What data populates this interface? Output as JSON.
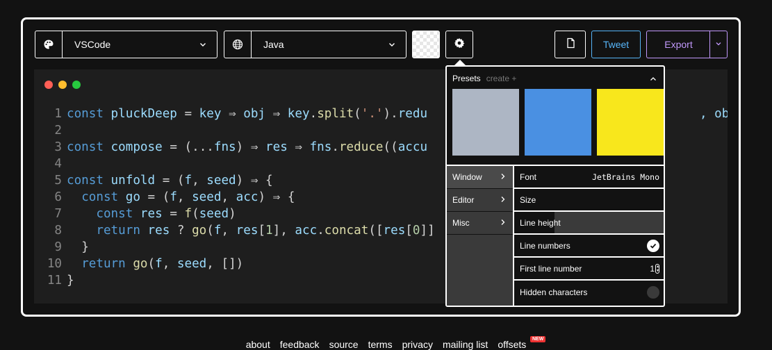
{
  "theme_select": {
    "value": "VSCode",
    "icon": "palette-icon"
  },
  "language_select": {
    "value": "Java",
    "icon": "globe-icon"
  },
  "actions": {
    "tweet_label": "Tweet",
    "export_label": "Export"
  },
  "window_dots": {
    "colors": [
      "#ff5f56",
      "#ffbd2e",
      "#27c93f"
    ]
  },
  "code": {
    "line_numbers": [
      "1",
      "2",
      "3",
      "4",
      "5",
      "6",
      "7",
      "8",
      "9",
      "10",
      "11"
    ],
    "lines": [
      "const pluckDeep = key ⇒ obj ⇒ key.split('.').redu",
      "",
      "const compose = (...fns) ⇒ res ⇒ fns.reduce((accu",
      "",
      "const unfold = (f, seed) ⇒ {",
      "  const go = (f, seed, acc) ⇒ {",
      "    const res = f(seed)",
      "    return res ? go(f, res[1], acc.concat([res[0]]",
      "  }",
      "  return go(f, seed, [])",
      "}"
    ],
    "line1_tail": ", obj)"
  },
  "settings_panel": {
    "presets_title": "Presets",
    "presets_create": "create +",
    "preset_colors": [
      "#adb6c4",
      "#4a90e2",
      "#f8e71c"
    ],
    "menu": [
      {
        "label": "Window",
        "active": true
      },
      {
        "label": "Editor",
        "active": false
      },
      {
        "label": "Misc",
        "active": false
      }
    ],
    "rows": {
      "font_label": "Font",
      "font_value": "JetBrains Mono",
      "size_label": "Size",
      "line_height_label": "Line height",
      "line_numbers_label": "Line numbers",
      "first_line_label": "First line number",
      "first_line_value": "1",
      "hidden_chars_label": "Hidden characters"
    }
  },
  "footer": {
    "links": [
      "about",
      "feedback",
      "source",
      "terms",
      "privacy",
      "mailing list",
      "offsets"
    ],
    "badge": "NEW"
  }
}
